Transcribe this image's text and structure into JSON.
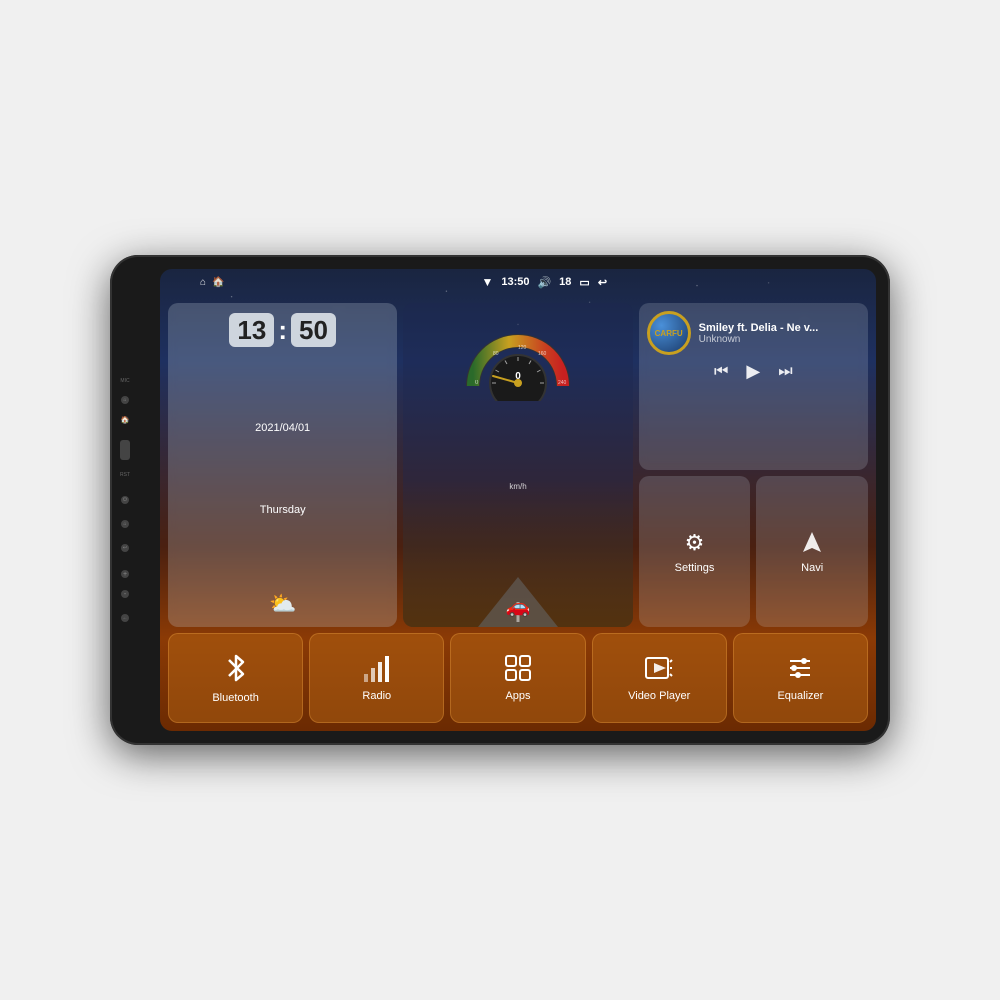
{
  "device": {
    "mic_label": "MIC",
    "rst_label": "RST"
  },
  "status_bar": {
    "wifi_icon": "▼",
    "time": "13:50",
    "volume_icon": "🔊",
    "volume_level": "18",
    "window_icon": "▭",
    "back_icon": "↩"
  },
  "clock": {
    "hours": "13",
    "minutes": "50",
    "date": "2021/04/01",
    "day": "Thursday",
    "weather_icon": "⛅"
  },
  "speedometer": {
    "value": "0",
    "unit": "km/h"
  },
  "music": {
    "logo": "CARFU",
    "title": "Smiley ft. Delia - Ne v...",
    "artist": "Unknown",
    "prev_icon": "⏮",
    "play_icon": "▶",
    "next_icon": "⏭"
  },
  "apps": {
    "settings": {
      "label": "Settings",
      "icon": "⚙"
    },
    "navi": {
      "label": "Navi",
      "icon": "⬆"
    }
  },
  "bottom_bar": [
    {
      "id": "bluetooth",
      "label": "Bluetooth",
      "icon": "bluetooth"
    },
    {
      "id": "radio",
      "label": "Radio",
      "icon": "radio"
    },
    {
      "id": "apps",
      "label": "Apps",
      "icon": "apps"
    },
    {
      "id": "video-player",
      "label": "Video Player",
      "icon": "video"
    },
    {
      "id": "equalizer",
      "label": "Equalizer",
      "icon": "equalizer"
    }
  ],
  "colors": {
    "accent": "#c8a020",
    "bg_dark": "#1a2540",
    "button_bg": "rgba(180,100,20,0.5)"
  }
}
